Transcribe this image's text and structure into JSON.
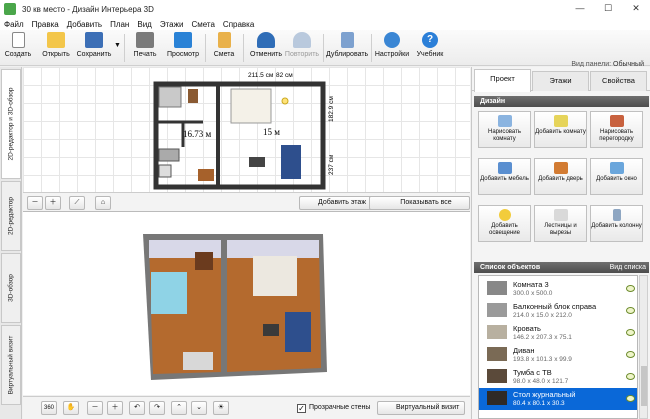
{
  "window": {
    "title": "30 кв место - Дизайн Интерьера 3D",
    "minimize": "—",
    "maximize": "☐",
    "close": "✕"
  },
  "menu": [
    "Файл",
    "Правка",
    "Добавить",
    "План",
    "Вид",
    "Этажи",
    "Смета",
    "Справка"
  ],
  "toolbar": {
    "buttons": [
      {
        "id": "create",
        "label": "Создать",
        "icon": "new-document-icon",
        "color": "#ffffff"
      },
      {
        "id": "open",
        "label": "Открыть",
        "icon": "folder-icon",
        "color": "#f3c64a"
      },
      {
        "id": "save",
        "label": "Сохранить",
        "icon": "floppy-icon",
        "color": "#3c6fb6"
      },
      {
        "id": "print",
        "label": "Печать",
        "icon": "printer-icon",
        "color": "#7a7a7a"
      },
      {
        "id": "preview",
        "label": "Просмотр",
        "icon": "monitor-icon",
        "color": "#2a82d6"
      },
      {
        "id": "estimate",
        "label": "Смета",
        "icon": "estimate-icon",
        "color": "#e9b14a"
      },
      {
        "id": "undo",
        "label": "Отменить",
        "icon": "undo-icon",
        "color": "#2f6db7"
      },
      {
        "id": "redo",
        "label": "Повторить",
        "icon": "redo-icon",
        "color": "#b9c9dd"
      },
      {
        "id": "duplicate",
        "label": "Дублировать",
        "icon": "duplicate-icon",
        "color": "#7da1cf"
      },
      {
        "id": "settings",
        "label": "Настройки",
        "icon": "gear-icon",
        "color": "#3a86d4"
      },
      {
        "id": "tutorial",
        "label": "Учебник",
        "icon": "help-icon",
        "color": "#2b7fd8"
      }
    ],
    "panel_view_label": "Вид панели:",
    "panel_view_value": "Обычный"
  },
  "left_tabs": [
    "2D-редактор и 3D-обзор",
    "2D-редактор",
    "3D-обзор",
    "Виртуальный визит"
  ],
  "plan2d": {
    "dims": [
      "211.5 см",
      "82 см",
      "182.9 см",
      "237 см"
    ],
    "room_labels": [
      "16.73 м",
      "15 м"
    ],
    "buttons": {
      "add_floor": "Добавить этаж",
      "show_all_sizes": "Показывать все размеры"
    },
    "icons": [
      "zoom-out-icon",
      "zoom-in-icon",
      "ruler-icon",
      "home-icon"
    ]
  },
  "view3d": {
    "icons": [
      "rotate-360-icon",
      "hand-icon",
      "zoom-out-icon",
      "zoom-in-icon",
      "orbit-left-icon",
      "orbit-right-icon",
      "tilt-up-icon",
      "tilt-down-icon",
      "light-icon"
    ],
    "transparent_walls": "Прозрачные стены",
    "transparent_walls_checked": true,
    "virtual_visit": "Виртуальный визит"
  },
  "right_panel": {
    "tabs": [
      "Проект",
      "Этажи",
      "Свойства"
    ],
    "active_tab": "Проект",
    "design_header": "Дизайн",
    "tools": [
      {
        "label": "Нарисовать комнату",
        "icon": "draw-room-icon",
        "color": "#8bb4e0"
      },
      {
        "label": "Добавить комнату",
        "icon": "add-room-icon",
        "color": "#e6d45a"
      },
      {
        "label": "Нарисовать перегородку",
        "icon": "brick-wall-icon",
        "color": "#c8613e"
      },
      {
        "label": "Добавить мебель",
        "icon": "chair-icon",
        "color": "#5a8fd0"
      },
      {
        "label": "Добавить дверь",
        "icon": "door-icon",
        "color": "#d27b32"
      },
      {
        "label": "Добавить окно",
        "icon": "window-icon",
        "color": "#6aa6dc"
      },
      {
        "label": "Добавить освещение",
        "icon": "lamp-icon",
        "color": "#f2cc3b"
      },
      {
        "label": "Лестницы и вырезы",
        "icon": "stairs-icon",
        "color": "#d9d9d9"
      },
      {
        "label": "Добавить колонну",
        "icon": "column-icon",
        "color": "#8ea6c2"
      }
    ],
    "objects_header": "Список объектов",
    "objects_view_label": "Вид списка",
    "objects": [
      {
        "name": "Комната 3",
        "size": "300.0 x 500.0",
        "thumb": "#888888",
        "selected": false
      },
      {
        "name": "Балконный блок справа",
        "size": "214.0 x 15.0 x 212.0",
        "thumb": "#9a9a9a",
        "selected": false
      },
      {
        "name": "Кровать",
        "size": "146.2 x 207.3 x 75.1",
        "thumb": "#b8b0a0",
        "selected": false
      },
      {
        "name": "Диван",
        "size": "193.8 x 101.3 x 99.9",
        "thumb": "#7a6a55",
        "selected": false
      },
      {
        "name": "Тумба с ТВ",
        "size": "98.0 x 48.0 x 121.7",
        "thumb": "#5b4a3a",
        "selected": false
      },
      {
        "name": "Стол журнальный",
        "size": "80.4 x 80.1 x 30.3",
        "thumb": "#2f2a26",
        "selected": true
      }
    ]
  },
  "colors": {
    "accent": "#0a68d8",
    "header_dark": "#555555",
    "floor_wood": "#b46a2e",
    "wall_gray": "#8a8a8a"
  }
}
